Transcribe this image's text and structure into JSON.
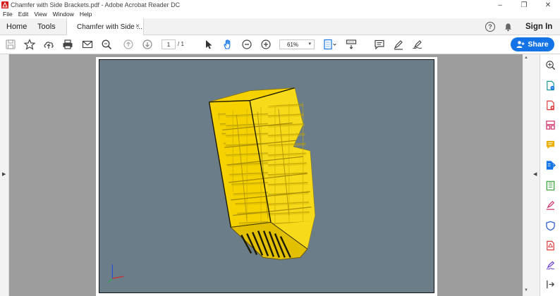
{
  "window": {
    "title": "Chamfer with Side Brackets.pdf - Adobe Acrobat Reader DC",
    "minimize": "–",
    "restore": "❐",
    "close": "✕"
  },
  "menu": [
    "File",
    "Edit",
    "View",
    "Window",
    "Help"
  ],
  "tabs": {
    "home": "Home",
    "tools": "Tools",
    "document": "Chamfer with Side ...",
    "close": "×"
  },
  "header_right": {
    "help": "?",
    "sign_in": "Sign In"
  },
  "toolbar": {
    "page_current": "1",
    "page_total": "/  1",
    "zoom": "61%",
    "share": "Share"
  },
  "colors": {
    "accent": "#1473e6",
    "render_background": "#6c7d8a",
    "model_yellow": "#f5d200"
  },
  "right_tools": [
    "zoom-tool-icon",
    "export-pdf-icon",
    "create-pdf-icon",
    "organize-pages-icon",
    "comment-icon",
    "edit-pdf-icon",
    "combine-files-icon",
    "fill-sign-icon",
    "protect-icon",
    "pdf-file-icon",
    "sign-icon",
    "more-tools-icon"
  ]
}
